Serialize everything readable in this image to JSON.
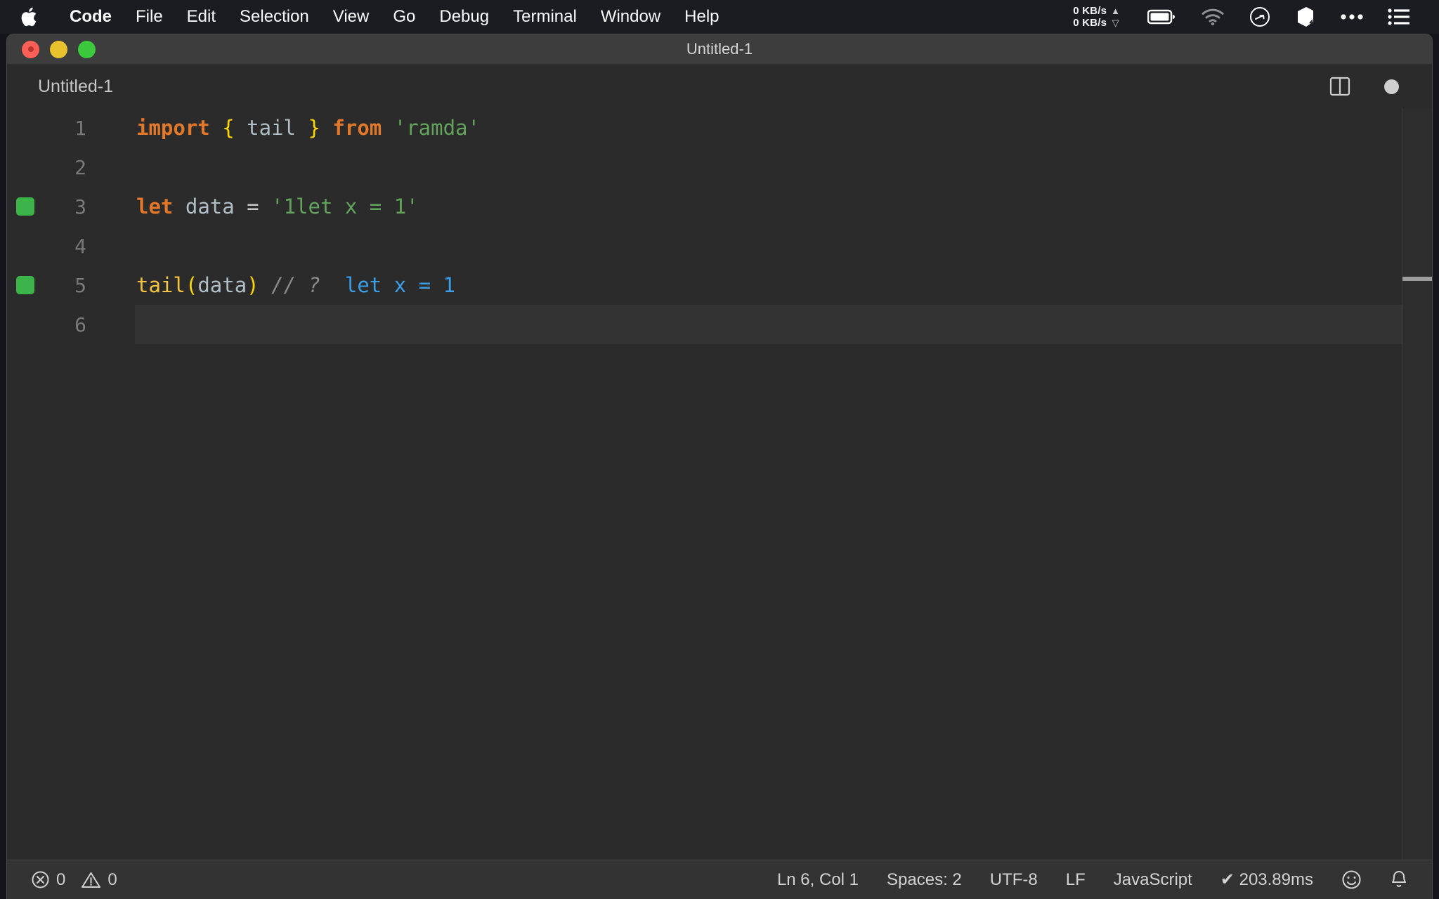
{
  "menubar": {
    "apple_icon": "apple-logo-icon",
    "items": [
      {
        "label": "Code",
        "bold": true
      },
      {
        "label": "File",
        "bold": false
      },
      {
        "label": "Edit",
        "bold": false
      },
      {
        "label": "Selection",
        "bold": false
      },
      {
        "label": "View",
        "bold": false
      },
      {
        "label": "Go",
        "bold": false
      },
      {
        "label": "Debug",
        "bold": false
      },
      {
        "label": "Terminal",
        "bold": false
      },
      {
        "label": "Window",
        "bold": false
      },
      {
        "label": "Help",
        "bold": false
      }
    ],
    "network": {
      "upload": "0 KB/s",
      "download": "0 KB/s",
      "up_arrow": "▲",
      "down_arrow": "▽"
    },
    "tray": [
      {
        "name": "battery-icon"
      },
      {
        "name": "wifi-icon"
      },
      {
        "name": "clock-icon"
      },
      {
        "name": "cube-icon"
      },
      {
        "name": "ellipsis-icon"
      },
      {
        "name": "list-menu-icon"
      }
    ]
  },
  "window": {
    "title": "Untitled-1",
    "traffic_lights": [
      "close",
      "minimize",
      "zoom"
    ]
  },
  "editor": {
    "tab_label": "Untitled-1",
    "split_icon": "split-editor-icon",
    "dirty_indicator": "unsaved-dot-icon",
    "current_line": 6,
    "lines": [
      {
        "number": "1",
        "marker": false,
        "current": false,
        "tokens": [
          {
            "t": "import",
            "c": "tok-keyword"
          },
          {
            "t": " ",
            "c": "tok-op"
          },
          {
            "t": "{",
            "c": "tok-brace"
          },
          {
            "t": " ",
            "c": "tok-op"
          },
          {
            "t": "tail",
            "c": "tok-var"
          },
          {
            "t": " ",
            "c": "tok-op"
          },
          {
            "t": "}",
            "c": "tok-brace"
          },
          {
            "t": " ",
            "c": "tok-op"
          },
          {
            "t": "from",
            "c": "tok-keyword"
          },
          {
            "t": " ",
            "c": "tok-op"
          },
          {
            "t": "'ramda'",
            "c": "tok-string"
          }
        ]
      },
      {
        "number": "2",
        "marker": false,
        "current": false,
        "tokens": []
      },
      {
        "number": "3",
        "marker": true,
        "current": false,
        "tokens": [
          {
            "t": "let",
            "c": "tok-keyword"
          },
          {
            "t": " ",
            "c": "tok-op"
          },
          {
            "t": "data",
            "c": "tok-var"
          },
          {
            "t": " ",
            "c": "tok-op"
          },
          {
            "t": "=",
            "c": "tok-op"
          },
          {
            "t": " ",
            "c": "tok-op"
          },
          {
            "t": "'1let x = 1'",
            "c": "tok-string"
          }
        ]
      },
      {
        "number": "4",
        "marker": false,
        "current": false,
        "tokens": []
      },
      {
        "number": "5",
        "marker": true,
        "current": false,
        "tokens": [
          {
            "t": "tail",
            "c": "tok-func"
          },
          {
            "t": "(",
            "c": "tok-paren"
          },
          {
            "t": "data",
            "c": "tok-var"
          },
          {
            "t": ")",
            "c": "tok-paren"
          },
          {
            "t": " ",
            "c": "tok-op"
          },
          {
            "t": "// ?",
            "c": "tok-comment"
          },
          {
            "t": "  ",
            "c": "tok-op"
          },
          {
            "t": "let x = 1",
            "c": "tok-result"
          }
        ]
      },
      {
        "number": "6",
        "marker": false,
        "current": true,
        "tokens": []
      }
    ]
  },
  "statusbar": {
    "error_icon": "error-circle-icon",
    "error_count": "0",
    "warning_icon": "warning-triangle-icon",
    "warning_count": "0",
    "cursor_position": "Ln 6, Col 1",
    "indentation": "Spaces: 2",
    "encoding": "UTF-8",
    "eol": "LF",
    "language": "JavaScript",
    "run_status": "✔ 203.89ms",
    "feedback_icon": "smiley-icon",
    "notifications_icon": "bell-icon"
  },
  "colors": {
    "menubar_bg": "#1b1c22",
    "titlebar_bg": "#3d3d3d",
    "editor_bg": "#2b2b2b",
    "current_line_bg": "#333334",
    "statusbar_bg": "#333333",
    "marker_green": "#3cb44a",
    "keyword_orange": "#e2792a",
    "string_green": "#63a35c",
    "brace_yellow": "#ffd700",
    "result_blue": "#3b9fe8"
  }
}
